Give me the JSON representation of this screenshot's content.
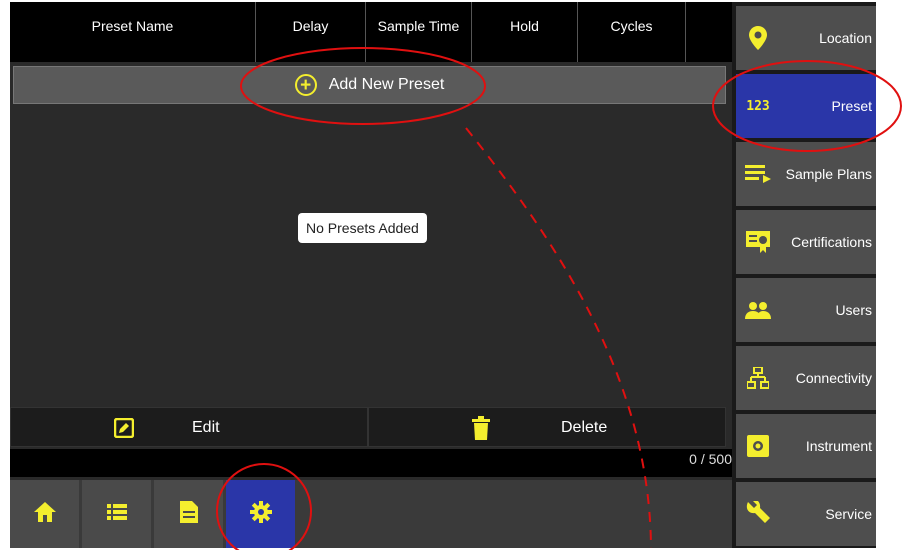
{
  "table": {
    "columns": [
      "Preset Name",
      "Delay",
      "Sample Time",
      "Hold",
      "Cycles"
    ]
  },
  "add_button": {
    "label": "Add New Preset"
  },
  "empty_message": "No Presets Added",
  "actions": {
    "edit_label": "Edit",
    "delete_label": "Delete"
  },
  "counter": "0 / 500",
  "bottom_nav": {
    "items": [
      {
        "name": "home",
        "icon": "home-icon",
        "active": false
      },
      {
        "name": "list",
        "icon": "list-icon",
        "active": false
      },
      {
        "name": "document",
        "icon": "document-icon",
        "active": false
      },
      {
        "name": "settings",
        "icon": "gear-icon",
        "active": true
      }
    ]
  },
  "sidebar": {
    "items": [
      {
        "label": "Location",
        "icon": "location-pin-icon",
        "active": false
      },
      {
        "label": "Preset",
        "icon": "numeric-123-icon",
        "icon_text": "123",
        "active": true
      },
      {
        "label": "Sample Plans",
        "icon": "playlist-icon",
        "active": false
      },
      {
        "label": "Certifications",
        "icon": "certificate-icon",
        "active": false
      },
      {
        "label": "Users",
        "icon": "users-icon",
        "active": false
      },
      {
        "label": "Connectivity",
        "icon": "network-icon",
        "active": false
      },
      {
        "label": "Instrument",
        "icon": "instrument-icon",
        "active": false
      },
      {
        "label": "Service",
        "icon": "wrench-icon",
        "active": false
      }
    ]
  },
  "colors": {
    "accent": "#f4ee2e",
    "active_blue": "#2a36a8",
    "annotation_red": "#e01010"
  }
}
